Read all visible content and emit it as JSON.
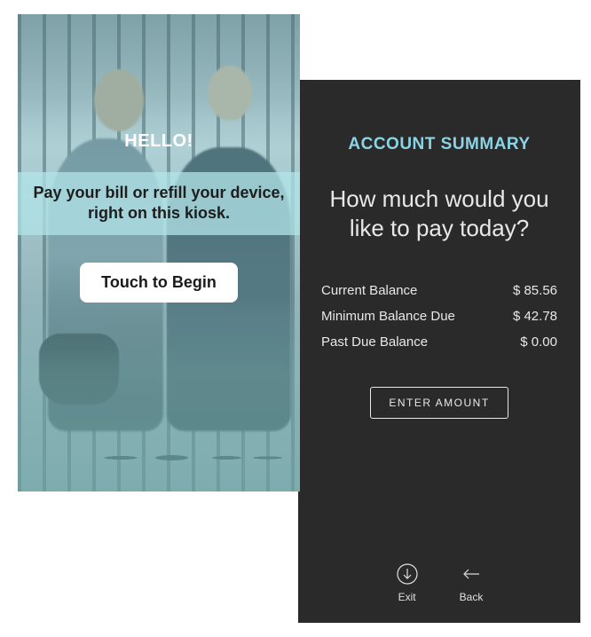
{
  "welcome": {
    "greeting": "HELLO!",
    "banner": "Pay your bill or refill your device, right on this kiosk.",
    "begin_label": "Touch to Begin"
  },
  "summary": {
    "title": "ACCOUNT SUMMARY",
    "question": "How much would you like to pay today?",
    "rows": [
      {
        "label": "Current Balance",
        "value": "$ 85.56"
      },
      {
        "label": "Minimum Balance Due",
        "value": "$ 42.78"
      },
      {
        "label": "Past Due Balance",
        "value": "$   0.00"
      }
    ],
    "enter_amount_label": "ENTER AMOUNT",
    "nav": {
      "exit_label": "Exit",
      "back_label": "Back"
    }
  }
}
